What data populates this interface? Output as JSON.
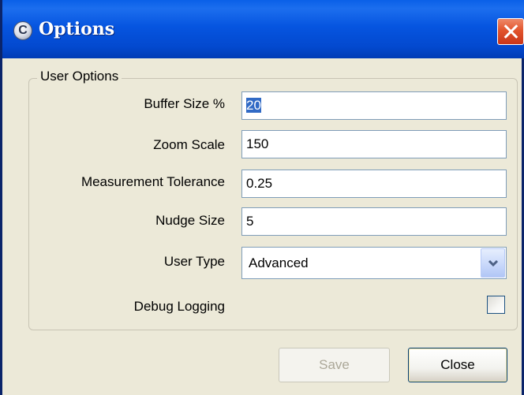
{
  "window": {
    "title": "Options",
    "app_icon_letter": "C"
  },
  "group": {
    "title": "User Options"
  },
  "fields": {
    "buffer_size": {
      "label": "Buffer Size %",
      "value": "20"
    },
    "zoom_scale": {
      "label": "Zoom Scale",
      "value": "150"
    },
    "measurement_tolerance": {
      "label": "Measurement Tolerance",
      "value": "0.25"
    },
    "nudge_size": {
      "label": "Nudge Size",
      "value": "5"
    },
    "user_type": {
      "label": "User Type",
      "value": "Advanced"
    },
    "debug_logging": {
      "label": "Debug Logging",
      "checked": false
    }
  },
  "buttons": {
    "save": "Save",
    "close": "Close"
  },
  "colors": {
    "titlebar": "#0655E0",
    "dialog_bg": "#ECE9D8",
    "selection": "#316AC5",
    "close_button": "#E2542C"
  },
  "icons": {
    "app": "app-logo-icon",
    "close": "close-icon",
    "dropdown": "chevron-down-icon"
  }
}
